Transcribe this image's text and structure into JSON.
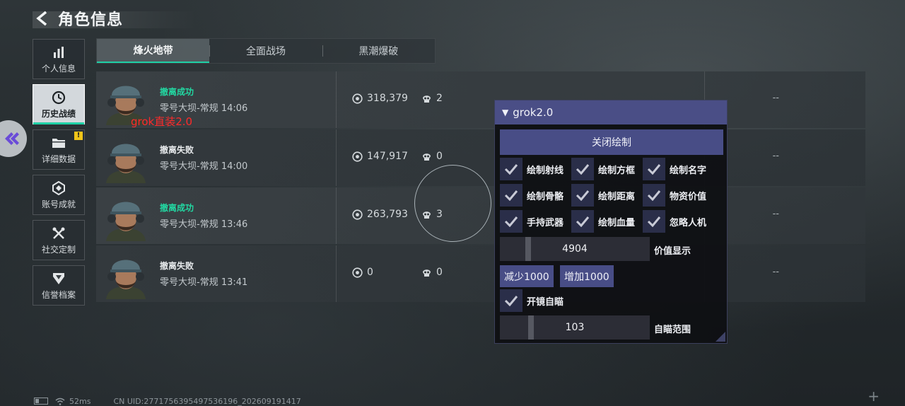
{
  "header": {
    "title": "角色信息",
    "back_icon": "chevron-left-icon"
  },
  "side_nav": [
    {
      "label": "个人信息",
      "icon": "bar-chart-icon",
      "active": false
    },
    {
      "label": "历史战绩",
      "icon": "clock-icon",
      "active": true
    },
    {
      "label": "详细数据",
      "icon": "folder-icon",
      "active": false,
      "badge": "!"
    },
    {
      "label": "账号成就",
      "icon": "achievement-icon",
      "active": false
    },
    {
      "label": "社交定制",
      "icon": "tools-icon",
      "active": false
    },
    {
      "label": "信誉档案",
      "icon": "shield-icon",
      "active": false
    }
  ],
  "tabs": [
    {
      "label": "烽火地带",
      "active": true
    },
    {
      "label": "全面战场",
      "active": false
    },
    {
      "label": "黑潮爆破",
      "active": false
    }
  ],
  "records": [
    {
      "status": "撤离成功",
      "success": true,
      "map": "零号大坝-常规",
      "time": "14:06",
      "value": "318,379",
      "kills": "2",
      "dash": "--"
    },
    {
      "status": "撤离失败",
      "success": false,
      "map": "零号大坝-常规",
      "time": "14:00",
      "value": "147,917",
      "kills": "0",
      "dash": "--"
    },
    {
      "status": "撤离成功",
      "success": true,
      "map": "零号大坝-常规",
      "time": "13:46",
      "value": "263,793",
      "kills": "3",
      "dash": "--"
    },
    {
      "status": "撤离失败",
      "success": false,
      "map": "零号大坝-常规",
      "time": "13:41",
      "value": "0",
      "kills": "0",
      "dash": "--"
    }
  ],
  "overlay_text": "grok直装2.0",
  "menu": {
    "title": "grok2.0",
    "close_draw": "关闭绘制",
    "checkboxes": [
      [
        "绘制射线",
        "绘制方框",
        "绘制名字"
      ],
      [
        "绘制骨骼",
        "绘制距离",
        "物资价值"
      ],
      [
        "手持武器",
        "绘制血量",
        "忽略人机"
      ]
    ],
    "value_slider": {
      "value": "4904",
      "label": "价值显示",
      "fraction": 0.17
    },
    "decrease_btn": "减少1000",
    "increase_btn": "增加1000",
    "scope_aim": "开镜自瞄",
    "aim_slider": {
      "value": "103",
      "label": "自瞄范围",
      "fraction": 0.19
    }
  },
  "footer": {
    "ping": "52ms",
    "uid": "CN UID:2771756395497536196_202609191417"
  },
  "colors": {
    "accent": "#1fd1a6",
    "success": "#22d8a2",
    "menu_header": "#4a4e86",
    "overlay_red": "#ff2a2a"
  }
}
